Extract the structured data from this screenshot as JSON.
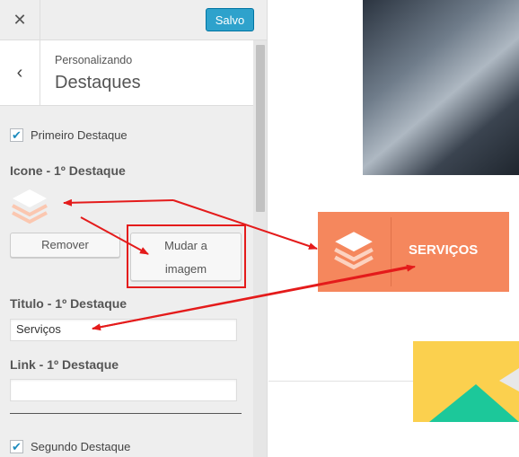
{
  "topbar": {
    "close_glyph": "✕",
    "save_label": "Salvo"
  },
  "section": {
    "back_glyph": "‹",
    "subtitle": "Personalizando",
    "title": "Destaques"
  },
  "feature1": {
    "enable_label": "Primeiro Destaque",
    "icon_title": "Icone - 1º Destaque",
    "remove_label": "Remover",
    "change_label_line1": "Mudar a",
    "change_label_line2": "imagem",
    "title_label": "Titulo - 1º Destaque",
    "title_value": "Serviços",
    "link_label": "Link - 1º Destaque",
    "link_value": ""
  },
  "feature2": {
    "enable_label": "Segundo Destaque"
  },
  "preview": {
    "box_label": "SERVIÇOS"
  },
  "colors": {
    "accent_blue": "#2ea2cc",
    "feature_orange": "#f5875d",
    "annotation_red": "#e41b1b",
    "card_yellow": "#fbd04e",
    "card_green": "#1cc89a"
  },
  "icons": {
    "check": "checkmark-icon",
    "layers": "layers-icon"
  }
}
